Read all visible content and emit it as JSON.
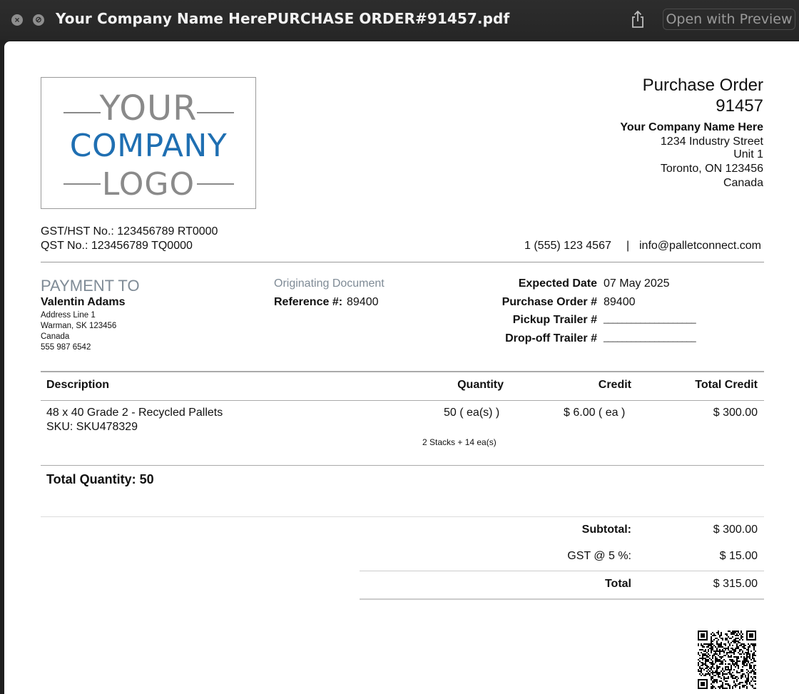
{
  "window": {
    "title": "Your Company Name HerePURCHASE ORDER#91457.pdf",
    "close_glyph": "×",
    "minimize_glyph": "⊘",
    "share_icon": "share-icon",
    "open_with_label": "Open with Preview"
  },
  "logo": {
    "line1": "YOUR",
    "line2": "COMPANY",
    "line3": "LOGO",
    "accent_color": "#1f6fb2",
    "gray_color": "#8a8a8a"
  },
  "header": {
    "doc_title": "Purchase Order",
    "doc_number": "91457",
    "company_name": "Your Company Name Here",
    "address": [
      "1234 Industry Street",
      "Unit 1",
      "Toronto, ON 123456",
      "Canada"
    ],
    "phone": "1 (555) 123 4567",
    "separator": "|",
    "email": "info@palletconnect.com",
    "gst": "GST/HST No.: 123456789 RT0000",
    "qst": "QST No.: 123456789 TQ0000"
  },
  "payment_to": {
    "heading": "PAYMENT TO",
    "name": "Valentin Adams",
    "lines": [
      "Address Line 1",
      "Warman, SK 123456",
      "Canada",
      "555 987 6542"
    ]
  },
  "originating": {
    "heading": "Originating Document",
    "ref_label": "Reference #:",
    "ref_value": "89400"
  },
  "details": {
    "expected_date_label": "Expected Date",
    "expected_date_value": "07 May 2025",
    "po_label": "Purchase Order #",
    "po_value": "89400",
    "pickup_label": "Pickup Trailer #",
    "pickup_value": "____________________",
    "dropoff_label": "Drop-off Trailer #",
    "dropoff_value": "____________________"
  },
  "table": {
    "columns": [
      "Description",
      "Quantity",
      "Credit",
      "Total Credit"
    ],
    "rows": [
      {
        "description": "48 x 40 Grade 2 - Recycled Pallets",
        "sku": "SKU: SKU478329",
        "quantity": "50 ( ea(s) )",
        "stacks": "2 Stacks + 14 ea(s)",
        "credit": "$ 6.00 ( ea )",
        "total": "$ 300.00"
      }
    ],
    "total_quantity": "Total Quantity: 50"
  },
  "totals": {
    "subtotal_label": "Subtotal:",
    "subtotal_value": "$ 300.00",
    "gst_label": "GST @ 5 %:",
    "gst_value": "$ 15.00",
    "total_label": "Total",
    "total_value": "$ 315.00"
  },
  "qr": {
    "icon": "qr-code-icon"
  }
}
